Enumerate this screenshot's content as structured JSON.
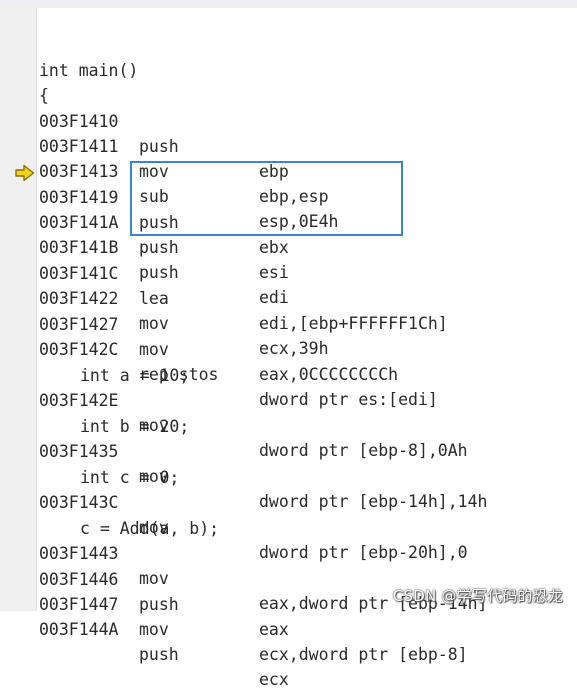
{
  "source": {
    "func_sig": "int main()",
    "open_brace": "{",
    "line_a": "int a = 10;",
    "line_b": "int b = 20;",
    "line_c": "int c = 0;",
    "line_add": "c = Add(a, b);"
  },
  "disassembly": [
    {
      "addr": "003F1410",
      "mnem": "push",
      "ops": "ebp"
    },
    {
      "addr": "003F1411",
      "mnem": "mov",
      "ops": "ebp,esp"
    },
    {
      "addr": "003F1413",
      "mnem": "sub",
      "ops": "esp,0E4h"
    },
    {
      "addr": "003F1419",
      "mnem": "push",
      "ops": "ebx"
    },
    {
      "addr": "003F141A",
      "mnem": "push",
      "ops": "esi"
    },
    {
      "addr": "003F141B",
      "mnem": "push",
      "ops": "edi"
    },
    {
      "addr": "003F141C",
      "mnem": "lea",
      "ops": "edi,[ebp+FFFFFF1Ch]"
    },
    {
      "addr": "003F1422",
      "mnem": "mov",
      "ops": "ecx,39h"
    },
    {
      "addr": "003F1427",
      "mnem": "mov",
      "ops": "eax,0CCCCCCCCh"
    },
    {
      "addr": "003F142C",
      "mnem": "rep stos",
      "ops": "dword ptr es:[edi]"
    },
    {
      "addr": "003F142E",
      "mnem": "mov",
      "ops": "dword ptr [ebp-8],0Ah"
    },
    {
      "addr": "003F1435",
      "mnem": "mov",
      "ops": "dword ptr [ebp-14h],14h"
    },
    {
      "addr": "003F143C",
      "mnem": "mov",
      "ops": "dword ptr [ebp-20h],0"
    },
    {
      "addr": "003F1443",
      "mnem": "mov",
      "ops": "eax,dword ptr [ebp-14h]"
    },
    {
      "addr": "003F1446",
      "mnem": "push",
      "ops": "eax"
    },
    {
      "addr": "003F1447",
      "mnem": "mov",
      "ops": "ecx,dword ptr [ebp-8]"
    },
    {
      "addr": "003F144A",
      "mnem": "push",
      "ops": "ecx"
    }
  ],
  "current_instruction_icon": "yellow-right-arrow-icon",
  "highlight_color": "#3b86c8",
  "watermark": "CSDN @学写代码的恐龙"
}
